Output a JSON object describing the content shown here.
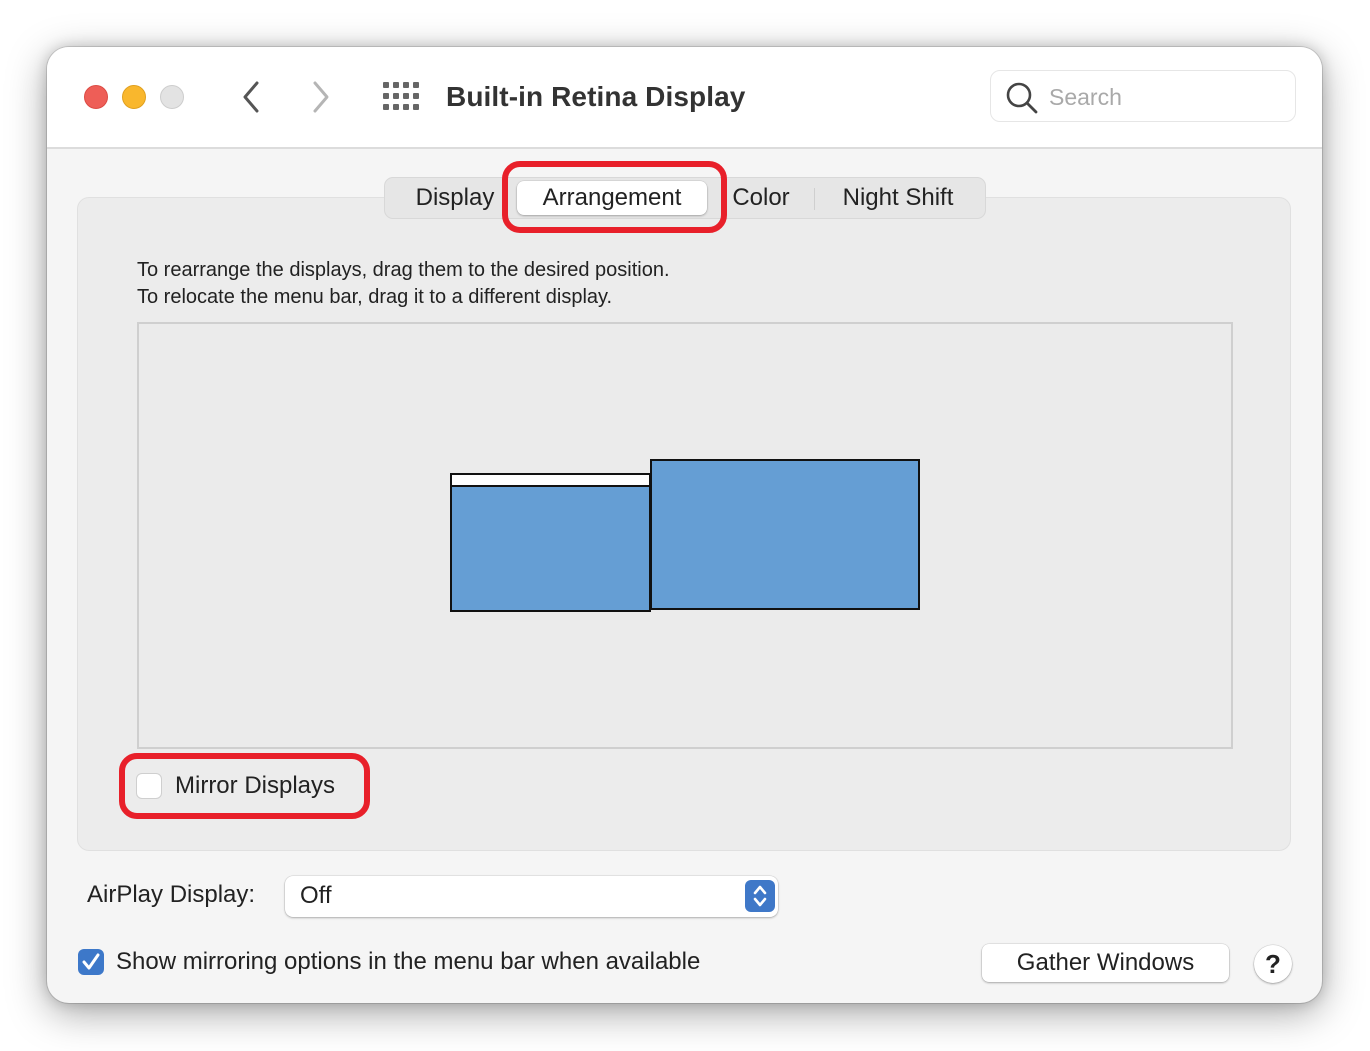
{
  "window": {
    "title": "Built-in Retina Display",
    "controls": [
      "close",
      "minimize",
      "zoom"
    ]
  },
  "toolbar": {
    "back_icon": "chevron-left-icon",
    "forward_icon": "chevron-right-icon",
    "show_all_icon": "grid-icon",
    "search": {
      "icon": "search-icon",
      "placeholder": "Search",
      "value": ""
    }
  },
  "tabs": [
    {
      "label": "Display",
      "selected": false
    },
    {
      "label": "Arrangement",
      "selected": true
    },
    {
      "label": "Color",
      "selected": false
    },
    {
      "label": "Night Shift",
      "selected": false
    }
  ],
  "arrangement": {
    "instruction_1": "To rearrange the displays, drag them to the desired position.",
    "instruction_2": "To relocate the menu bar, drag it to a different display.",
    "displays": [
      {
        "name": "built-in-display",
        "has_menu_bar": true,
        "color": "#659ed4"
      },
      {
        "name": "external-display",
        "has_menu_bar": false,
        "color": "#659ed4"
      }
    ]
  },
  "mirror_displays": {
    "label": "Mirror Displays",
    "checked": false
  },
  "airplay": {
    "label": "AirPlay Display:",
    "selected": "Off"
  },
  "show_mirroring": {
    "label": "Show mirroring options in the menu bar when available",
    "checked": true
  },
  "buttons": {
    "gather_windows": "Gather Windows",
    "help": "?"
  },
  "annotations": {
    "highlight_color": "#e8202a",
    "highlighted": [
      "Arrangement tab",
      "Mirror Displays checkbox"
    ]
  },
  "colors": {
    "accent": "#3d78c9",
    "display_fill": "#659ed4",
    "close": "#ee5e57",
    "minimize": "#f9b72d",
    "zoom_disabled": "#e3e3e3"
  }
}
